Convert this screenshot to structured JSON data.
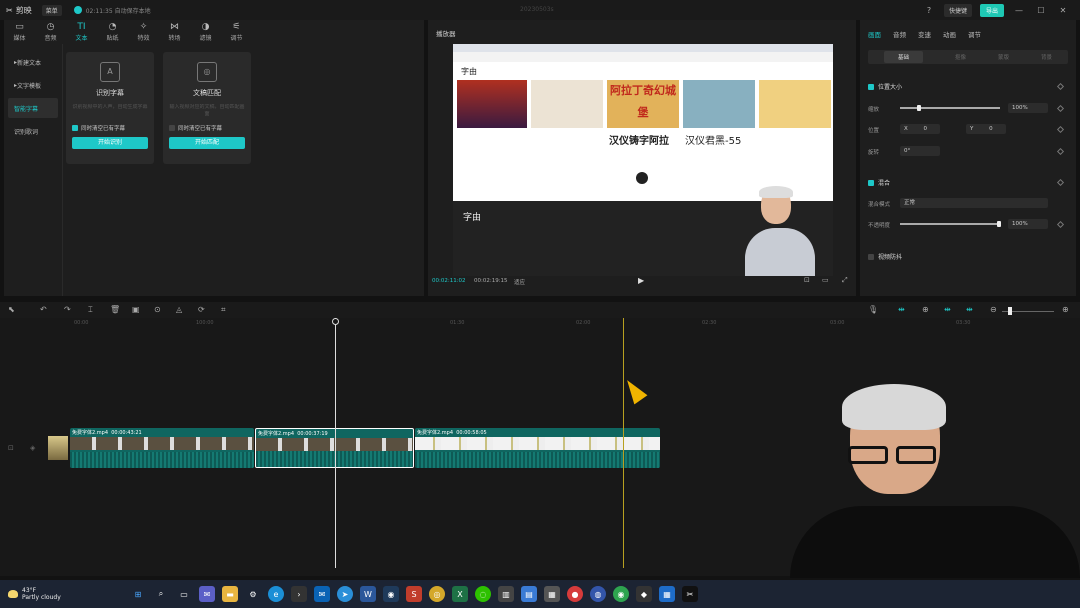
{
  "titlebar": {
    "app_name": "剪映",
    "menu": "菜单",
    "save_status": "02:11:35 自动保存本地",
    "project_title": "20230503s",
    "shortcut": "快捷键",
    "export": "导出"
  },
  "toolbar": {
    "items": [
      "媒体",
      "音频",
      "文本",
      "贴纸",
      "特效",
      "转场",
      "滤镜",
      "调节"
    ],
    "active": "文本"
  },
  "sidebar": {
    "items": [
      "新建文本",
      "文字模板",
      "智能字幕",
      "识别歌词"
    ],
    "active": "智能字幕"
  },
  "cards": [
    {
      "title": "识别字幕",
      "desc": "识别视频中的人声，自动生成字幕",
      "check": "同时清空已有字幕",
      "button": "开始识别"
    },
    {
      "title": "文稿匹配",
      "desc": "输入视频对应的文稿，自动匹配画面",
      "check": "同时清空已有字幕",
      "button": "开始匹配"
    }
  ],
  "player": {
    "title": "播放器",
    "current_time": "00:02:11:02",
    "total_time": "00:02:19:15",
    "ratio": "适应",
    "screen": {
      "site": "字由",
      "fonts": [
        "阿拉丁奇幻城堡",
        "汉仪铸字阿拉",
        "汉仪君黑-55"
      ],
      "footer_logo": "字由"
    }
  },
  "inspector": {
    "tabs": [
      "画面",
      "音频",
      "变速",
      "动画",
      "调节"
    ],
    "active_tab": "画面",
    "subtabs": [
      "基础",
      "抠像",
      "蒙版",
      "背景"
    ],
    "active_subtab": "基础",
    "position_size": "位置大小",
    "scale_label": "缩放",
    "scale_value": "100%",
    "position_label": "位置",
    "x_label": "X",
    "x_value": "0",
    "y_label": "Y",
    "y_value": "0",
    "rotate_label": "旋转",
    "rotate_value": "0°",
    "blend": "混合",
    "blend_mode_label": "混合模式",
    "blend_mode_value": "正常",
    "opacity_label": "不透明度",
    "opacity_value": "100%",
    "stabilize": "视频防抖"
  },
  "timeline": {
    "ticks": [
      "00:00",
      "100:00",
      "01:30",
      "02:00",
      "02:30",
      "03:00",
      "03:30"
    ],
    "clips": [
      {
        "name": "免费字体2.mp4",
        "duration": "00:00:43:21"
      },
      {
        "name": "免费字体2.mp4",
        "duration": "00:00:37:19"
      },
      {
        "name": "免费字体2.mp4",
        "duration": "00:00:58:05"
      }
    ]
  },
  "taskbar": {
    "temp": "43°F",
    "weather": "Partly cloudy"
  }
}
